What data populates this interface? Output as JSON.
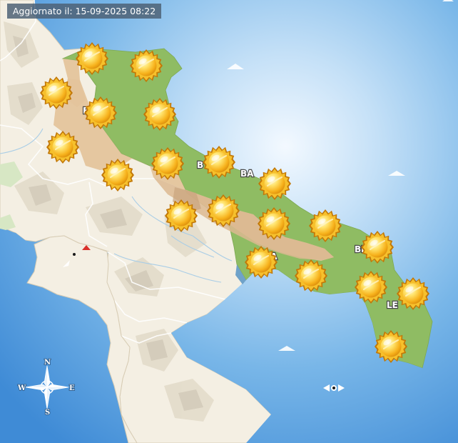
{
  "header": {
    "updated_label": "Aggiornato il: 15-09-2025 08:22"
  },
  "weather_icon_name": "sunny-icon",
  "weather_icons": [
    {
      "name": "sun-1"
    },
    {
      "name": "sun-2"
    },
    {
      "name": "sun-3"
    },
    {
      "name": "sun-4"
    },
    {
      "name": "sun-5"
    },
    {
      "name": "sun-6"
    },
    {
      "name": "sun-7"
    },
    {
      "name": "sun-8"
    },
    {
      "name": "sun-9"
    },
    {
      "name": "sun-10"
    },
    {
      "name": "sun-11"
    },
    {
      "name": "sun-12"
    },
    {
      "name": "sun-13"
    },
    {
      "name": "sun-14"
    },
    {
      "name": "sun-15"
    },
    {
      "name": "sun-16"
    },
    {
      "name": "sun-17"
    },
    {
      "name": "sun-18"
    },
    {
      "name": "sun-19"
    },
    {
      "name": "sun-20"
    },
    {
      "name": "sun-21"
    }
  ],
  "province_labels": {
    "foggia": "F",
    "bat": "B",
    "bari": "BA",
    "taranto": "TA",
    "brindisi": "BR",
    "lecce": "LE"
  },
  "compass": {
    "north": "N",
    "south": "S",
    "east": "E",
    "west": "W"
  },
  "colors": {
    "sea_light": "#d4ebfb",
    "sea_dark": "#4e98dc",
    "land": "#f4efe3",
    "region_plain": "#8fbc63",
    "region_hills": "#e4c49c",
    "stamp_bg": "#4e6176"
  }
}
